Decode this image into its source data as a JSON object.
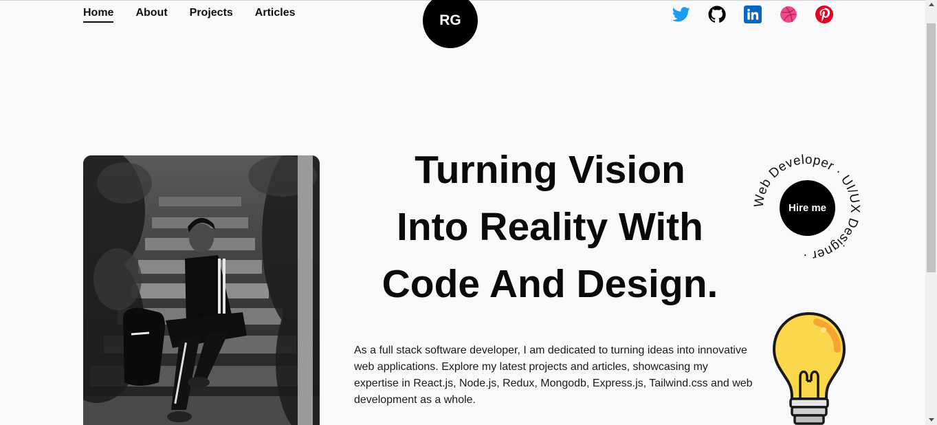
{
  "nav": {
    "items": [
      {
        "label": "Home",
        "active": true
      },
      {
        "label": "About",
        "active": false
      },
      {
        "label": "Projects",
        "active": false
      },
      {
        "label": "Articles",
        "active": false
      }
    ]
  },
  "logo": {
    "text": "RG"
  },
  "socials": [
    {
      "icon": "twitter-icon",
      "color": "#1d9bf0"
    },
    {
      "icon": "github-icon",
      "color": "#000000"
    },
    {
      "icon": "linkedin-icon",
      "color": "#0a66c2"
    },
    {
      "icon": "dribbble-icon",
      "color": "#ea4c89"
    },
    {
      "icon": "pinterest-icon",
      "color": "#e60023"
    }
  ],
  "hero": {
    "headline_line1": "Turning Vision",
    "headline_line2": "Into Reality With",
    "headline_line3": "Code And Design.",
    "description": "As a full stack software developer, I am dedicated to turning ideas into innovative web applications. Explore my latest projects and articles, showcasing my expertise in React.js, Node.js, Redux, Mongodb, Express.js, Tailwind.css and web development as a whole."
  },
  "badge": {
    "ring_text": "Web Developer · UI/UX Designer · ",
    "hire_label": "Hire me"
  },
  "colors": {
    "background": "#f8f9fb",
    "accent": "#000000",
    "bulb": "#fbd74c"
  }
}
